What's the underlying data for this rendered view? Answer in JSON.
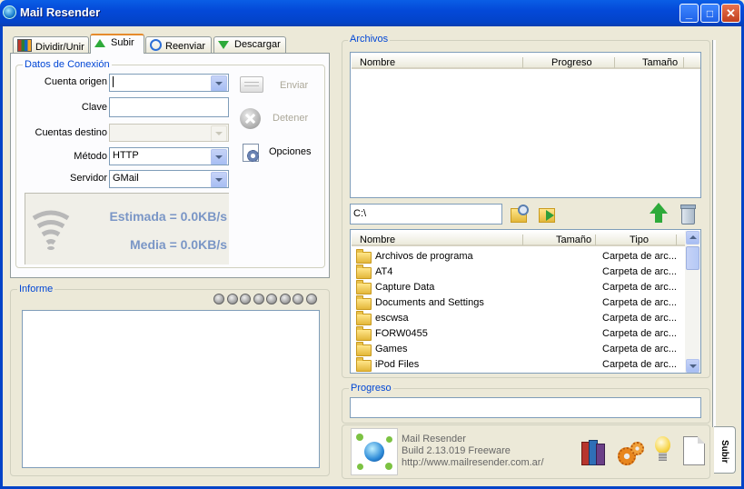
{
  "window": {
    "title": "Mail Resender",
    "minimize": "_",
    "maximize": "□",
    "close": "✕"
  },
  "tabs": [
    {
      "label": "Dividir/Unir",
      "icon": "split-join-icon"
    },
    {
      "label": "Subir",
      "icon": "up-arrow-icon",
      "active": true
    },
    {
      "label": "Reenviar",
      "icon": "refresh-arrows-icon"
    },
    {
      "label": "Descargar",
      "icon": "down-arrow-icon"
    }
  ],
  "connection": {
    "group_label": "Datos de Conexión",
    "account_label": "Cuenta origen",
    "account_value": "",
    "password_label": "Clave",
    "password_value": "",
    "dest_label": "Cuentas destino",
    "dest_value": "",
    "method_label": "Método",
    "method_value": "HTTP",
    "server_label": "Servidor",
    "server_value": "GMail"
  },
  "actions": {
    "send": "Enviar",
    "stop": "Detener",
    "options": "Opciones"
  },
  "speed": {
    "estimated": "Estimada = 0.0KB/s",
    "average": "Media = 0.0KB/s"
  },
  "report": {
    "label": "Informe",
    "led_count": 8
  },
  "files": {
    "label": "Archivos",
    "columns": [
      "Nombre",
      "Progreso",
      "Tamaño"
    ]
  },
  "browser": {
    "path": "C:\\",
    "columns": [
      "Nombre",
      "Tamaño",
      "Tipo"
    ],
    "rows": [
      {
        "name": "Archivos de programa",
        "size": "",
        "type": "Carpeta de arc..."
      },
      {
        "name": "AT4",
        "size": "",
        "type": "Carpeta de arc..."
      },
      {
        "name": "Capture Data",
        "size": "",
        "type": "Carpeta de arc..."
      },
      {
        "name": "Documents and Settings",
        "size": "",
        "type": "Carpeta de arc..."
      },
      {
        "name": "escwsa",
        "size": "",
        "type": "Carpeta de arc..."
      },
      {
        "name": "FORW0455",
        "size": "",
        "type": "Carpeta de arc..."
      },
      {
        "name": "Games",
        "size": "",
        "type": "Carpeta de arc..."
      },
      {
        "name": "iPod Files",
        "size": "",
        "type": "Carpeta de arc..."
      }
    ]
  },
  "progress": {
    "label": "Progreso"
  },
  "about": {
    "name": "Mail Resender",
    "build": "Build 2.13.019 Freeware",
    "url": "http://www.mailresender.com.ar/"
  },
  "side_tab": {
    "label": "Subir"
  }
}
